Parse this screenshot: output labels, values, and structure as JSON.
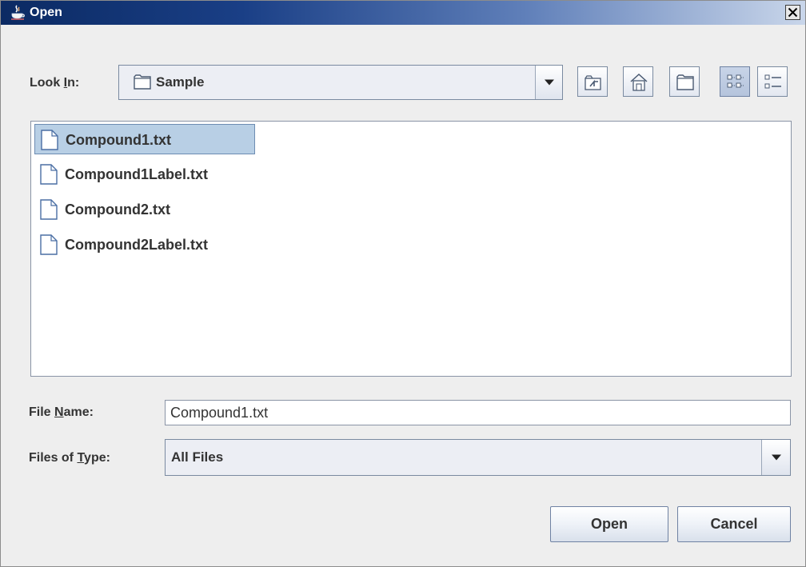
{
  "window": {
    "title": "Open"
  },
  "look_in": {
    "label": "Look ",
    "mnemonic": "I",
    "label_rest": "n:",
    "value": "Sample"
  },
  "toolbar": {
    "icons": [
      "up-folder-icon",
      "home-icon",
      "new-folder-icon",
      "list-view-icon",
      "details-view-icon"
    ]
  },
  "files": [
    {
      "name": "Compound1.txt",
      "selected": true
    },
    {
      "name": "Compound1Label.txt",
      "selected": false
    },
    {
      "name": "Compound2.txt",
      "selected": false
    },
    {
      "name": "Compound2Label.txt",
      "selected": false
    }
  ],
  "file_name": {
    "label": "File ",
    "mnemonic": "N",
    "label_rest": "ame:",
    "value": "Compound1.txt"
  },
  "file_type": {
    "label": "Files of ",
    "mnemonic": "T",
    "label_rest": "ype:",
    "value": "All Files"
  },
  "buttons": {
    "open": "Open",
    "cancel": "Cancel"
  },
  "colors": {
    "title_gradient_start": "#0b2a63",
    "selection": "#b8cfe5",
    "panel": "#eeeeee"
  }
}
